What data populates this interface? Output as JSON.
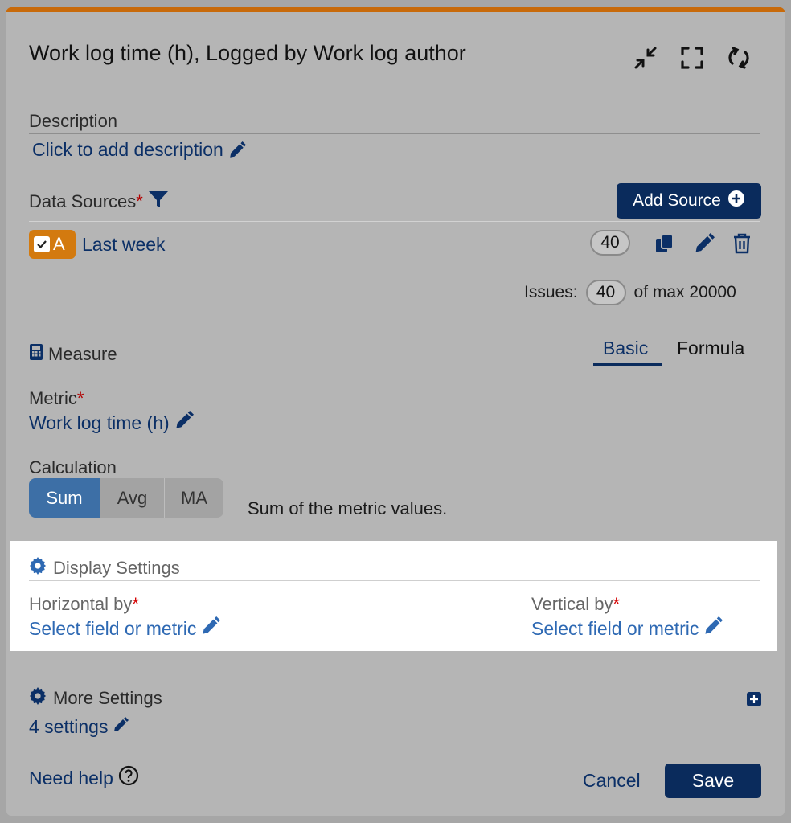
{
  "header": {
    "title": "Work log time (h), Logged by Work log author",
    "icons": [
      "collapse-icon",
      "fullscreen-icon",
      "refresh-icon"
    ]
  },
  "description": {
    "label": "Description",
    "link": "Click to add description"
  },
  "data_sources": {
    "label": "Data Sources",
    "add_button": "Add Source",
    "items": [
      {
        "letter": "A",
        "name": "Last week",
        "count": "40"
      }
    ],
    "issues_label": "Issues:",
    "issues_count": "40",
    "issues_max": "of max 20000"
  },
  "measure": {
    "label": "Measure",
    "tabs": {
      "basic": "Basic",
      "formula": "Formula"
    },
    "metric_label": "Metric",
    "metric_value": "Work log time (h)",
    "calculation_label": "Calculation",
    "calculation_options": [
      "Sum",
      "Avg",
      "MA"
    ],
    "calculation_desc": "Sum of the metric values."
  },
  "display_settings": {
    "label": "Display Settings",
    "horizontal_label": "Horizontal by",
    "horizontal_value": "Select field or metric",
    "vertical_label": "Vertical by",
    "vertical_value": "Select field or metric"
  },
  "more_settings": {
    "label": "More Settings",
    "link": "4 settings"
  },
  "footer": {
    "help": "Need help",
    "cancel": "Cancel",
    "save": "Save"
  },
  "colors": {
    "accent": "#c86a0a",
    "primary": "#0a2b5c",
    "link": "#0b2f66"
  }
}
